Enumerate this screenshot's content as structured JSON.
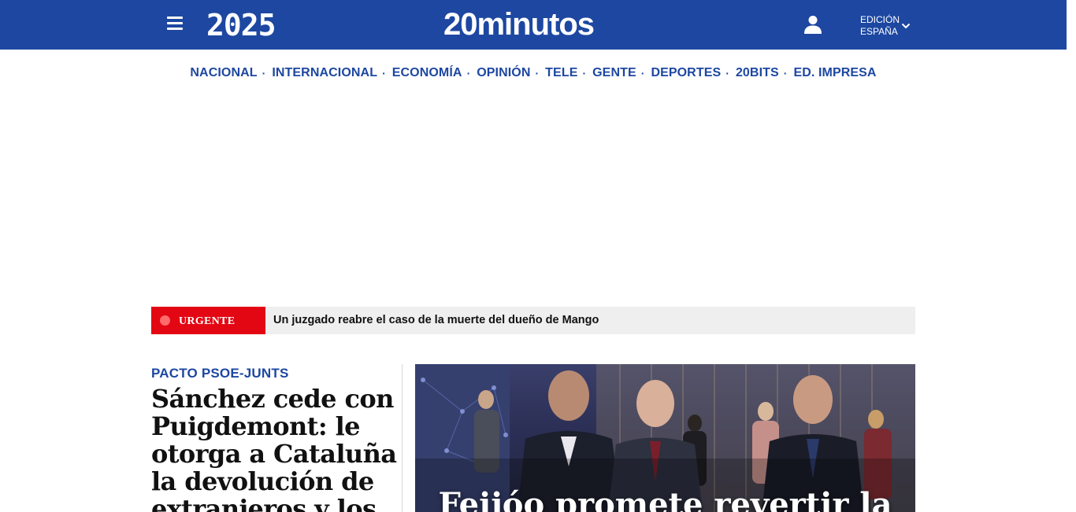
{
  "header": {
    "year": "2025",
    "brand": "20minutos",
    "edition_line1": "EDICIÓN",
    "edition_line2": "ESPAÑA",
    "background_color": "#1d47a1",
    "icons": [
      "menu-icon",
      "user-icon",
      "chevron-down-icon"
    ]
  },
  "nav": {
    "items": [
      {
        "label": "NACIONAL"
      },
      {
        "label": "INTERNACIONAL"
      },
      {
        "label": "ECONOMÍA"
      },
      {
        "label": "OPINIÓN"
      },
      {
        "label": "TELE"
      },
      {
        "label": "GENTE"
      },
      {
        "label": "DEPORTES"
      },
      {
        "label": "20BITS"
      },
      {
        "label": "ED. IMPRESA"
      }
    ],
    "separator": "·",
    "color": "#1d47a1"
  },
  "urgent": {
    "tag": "URGENTE",
    "text": "Un juzgado reabre el caso de la muerte del dueño de Mango",
    "tag_color": "#e30613"
  },
  "main_story": {
    "kicker": "PACTO PSOE-JUNTS",
    "headline": "Sánchez cede con Puigdemont: le otorga a Cataluña la devolución de extranjeros y los"
  },
  "photo_story": {
    "title": "Feijóo promete revertir la"
  }
}
